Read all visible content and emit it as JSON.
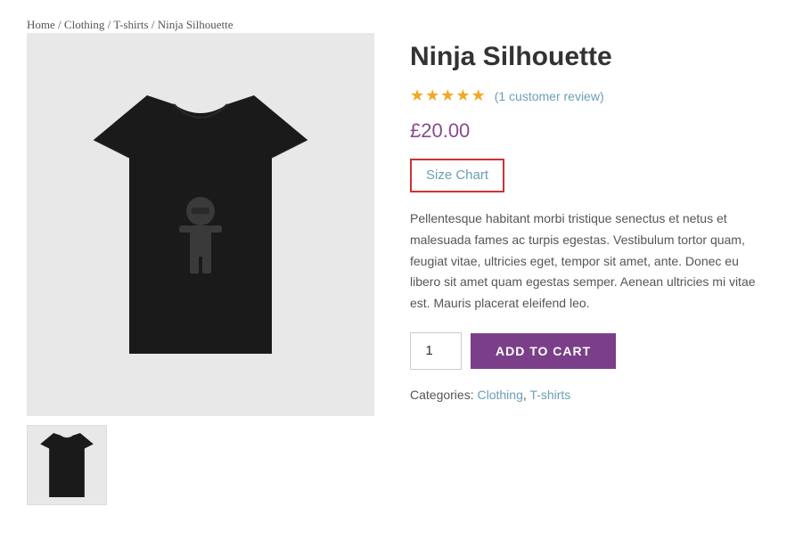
{
  "breadcrumb": {
    "items": [
      {
        "label": "Home",
        "href": "#"
      },
      {
        "label": "Clothing",
        "href": "#"
      },
      {
        "label": "T-shirts",
        "href": "#"
      },
      {
        "label": "Ninja Silhouette",
        "href": "#"
      }
    ],
    "separator": " / "
  },
  "product": {
    "title": "Ninja Silhouette",
    "rating": {
      "value": 5,
      "max": 5,
      "review_text": "(1 customer review)",
      "stars": [
        "★",
        "★",
        "★",
        "★",
        "★"
      ]
    },
    "price": "£20.00",
    "size_chart_label": "Size Chart",
    "description": "Pellentesque habitant morbi tristique senectus et netus et malesuada fames ac turpis egestas. Vestibulum tortor quam, feugiat vitae, ultricies eget, tempor sit amet, ante. Donec eu libero sit amet quam egestas semper. Aenean ultricies mi vitae est. Mauris placerat eleifend leo.",
    "quantity_value": "1",
    "add_to_cart_label": "ADD TO CART",
    "categories_label": "Categories:",
    "categories": [
      {
        "label": "Clothing",
        "href": "#"
      },
      {
        "label": "T-shirts",
        "href": "#"
      }
    ]
  },
  "colors": {
    "accent": "#7b3f8a",
    "link": "#6a9fb5",
    "price": "#8a4a8a",
    "border_red": "#cc3333",
    "star": "#f5a623"
  }
}
